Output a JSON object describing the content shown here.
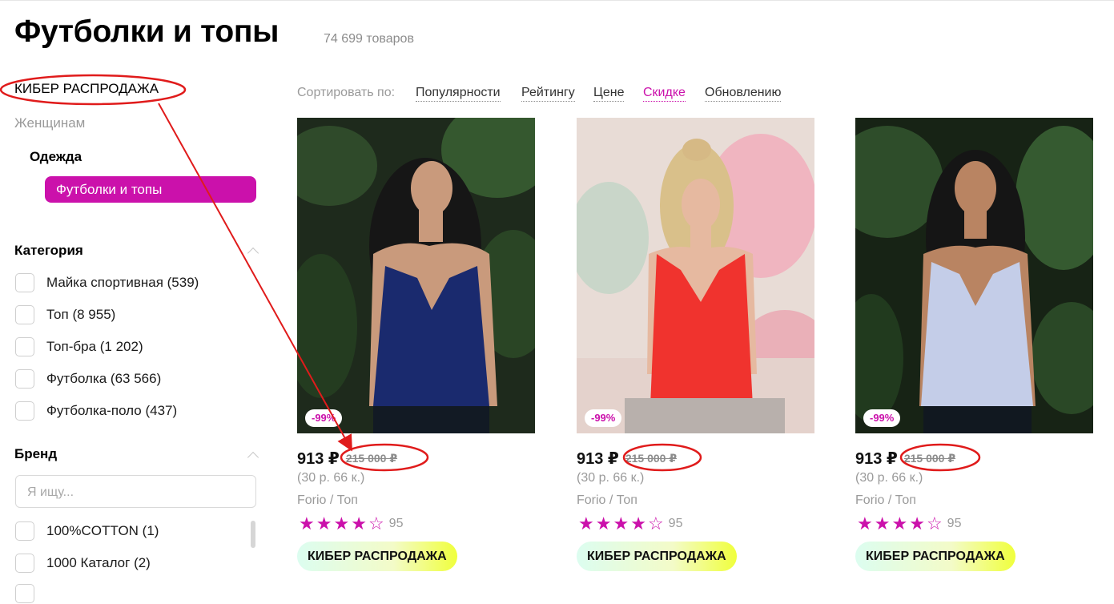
{
  "page": {
    "title": "Футболки и топы",
    "count": "74 699 товаров"
  },
  "nav": {
    "section": "КИБЕР РАСПРОДАЖА",
    "women": "Женщинам",
    "clothes": "Одежда",
    "active": "Футболки и топы"
  },
  "filters": {
    "category": {
      "title": "Категория",
      "items": [
        {
          "label": "Майка спортивная (539)"
        },
        {
          "label": "Топ (8 955)"
        },
        {
          "label": "Топ-бра (1 202)"
        },
        {
          "label": "Футболка (63 566)"
        },
        {
          "label": "Футболка-поло (437)"
        }
      ]
    },
    "brand": {
      "title": "Бренд",
      "search_placeholder": "Я ищу...",
      "items": [
        {
          "label": "100%COTTON (1)"
        },
        {
          "label": "1000 Каталог (2)"
        }
      ]
    }
  },
  "sort": {
    "label": "Сортировать по:",
    "options": [
      "Популярности",
      "Рейтингу",
      "Цене",
      "Скидке",
      "Обновлению"
    ],
    "active": "Скидке"
  },
  "products": [
    {
      "discount": "-99%",
      "price": "913 ₽",
      "old_price": "215 000 ₽",
      "per": "(30 р. 66 к.)",
      "brand": "Forio / Топ",
      "rating": 4,
      "reviews": "95",
      "badge": "КИБЕР РАСПРОДАЖА",
      "top_color": "#1a2a6e"
    },
    {
      "discount": "-99%",
      "price": "913 ₽",
      "old_price": "215 000 ₽",
      "per": "(30 р. 66 к.)",
      "brand": "Forio / Топ",
      "rating": 4,
      "reviews": "95",
      "badge": "КИБЕР РАСПРОДАЖА",
      "top_color": "#f0332e"
    },
    {
      "discount": "-99%",
      "price": "913 ₽",
      "old_price": "215 000 ₽",
      "per": "(30 р. 66 к.)",
      "brand": "Forio / Топ",
      "rating": 4,
      "reviews": "95",
      "badge": "КИБЕР РАСПРОДАЖА",
      "top_color": "#c4cde8"
    }
  ],
  "colors": {
    "accent": "#cb11ab",
    "annotation": "#e01b1b"
  }
}
